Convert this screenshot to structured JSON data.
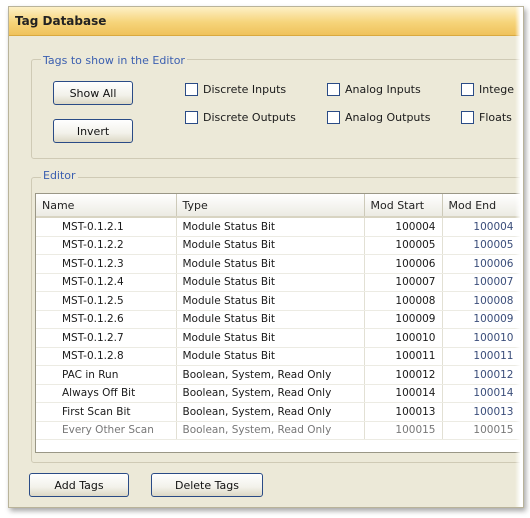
{
  "window": {
    "title": "Tag Database"
  },
  "filter": {
    "group_label": "Tags to show in the Editor",
    "show_all_label": "Show All",
    "invert_label": "Invert",
    "checkboxes": [
      {
        "label": "Discrete Inputs"
      },
      {
        "label": "Analog Inputs"
      },
      {
        "label": "Intege"
      },
      {
        "label": "Discrete Outputs"
      },
      {
        "label": "Analog Outputs"
      },
      {
        "label": "Floats"
      }
    ]
  },
  "editor": {
    "group_label": "Editor",
    "columns": [
      "Name",
      "Type",
      "Mod Start",
      "Mod End"
    ],
    "rows": [
      {
        "name": "MST-0.1.2.1",
        "type": "Module Status Bit",
        "mod_start": "100004",
        "mod_end": "100004"
      },
      {
        "name": "MST-0.1.2.2",
        "type": "Module Status Bit",
        "mod_start": "100005",
        "mod_end": "100005"
      },
      {
        "name": "MST-0.1.2.3",
        "type": "Module Status Bit",
        "mod_start": "100006",
        "mod_end": "100006"
      },
      {
        "name": "MST-0.1.2.4",
        "type": "Module Status Bit",
        "mod_start": "100007",
        "mod_end": "100007"
      },
      {
        "name": "MST-0.1.2.5",
        "type": "Module Status Bit",
        "mod_start": "100008",
        "mod_end": "100008"
      },
      {
        "name": "MST-0.1.2.6",
        "type": "Module Status Bit",
        "mod_start": "100009",
        "mod_end": "100009"
      },
      {
        "name": "MST-0.1.2.7",
        "type": "Module Status Bit",
        "mod_start": "100010",
        "mod_end": "100010"
      },
      {
        "name": "MST-0.1.2.8",
        "type": "Module Status Bit",
        "mod_start": "100011",
        "mod_end": "100011"
      },
      {
        "name": "PAC in Run",
        "type": "Boolean, System, Read Only",
        "mod_start": "100012",
        "mod_end": "100012"
      },
      {
        "name": "Always Off Bit",
        "type": "Boolean, System, Read Only",
        "mod_start": "100014",
        "mod_end": "100014"
      },
      {
        "name": "First Scan Bit",
        "type": "Boolean, System, Read Only",
        "mod_start": "100013",
        "mod_end": "100013"
      },
      {
        "name": "Every Other Scan",
        "type": "Boolean, System, Read Only",
        "mod_start": "100015",
        "mod_end": "100015"
      }
    ]
  },
  "footer": {
    "add_tags_label": "Add Tags",
    "delete_tags_label": "Delete Tags"
  }
}
